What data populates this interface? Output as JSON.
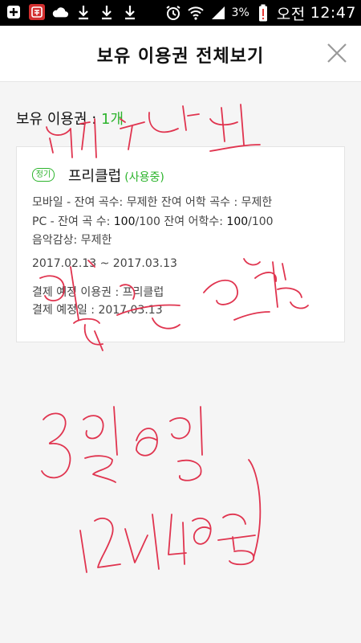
{
  "status_bar": {
    "battery_percent": "3%",
    "ampm": "오전",
    "time": "12:47",
    "icons": [
      "add-icon",
      "app-notification-icon",
      "cloud-icon",
      "download-icon",
      "download-icon",
      "download-icon",
      "alarm-icon",
      "wifi-icon",
      "signal-icon",
      "battery-low-icon"
    ]
  },
  "header": {
    "title": "보유 이용권 전체보기",
    "close_icon": "close-icon"
  },
  "summary": {
    "label": "보유 이용권 :",
    "count": "1개"
  },
  "pass": {
    "tag": "정기",
    "name": "프리클럽",
    "status": "(사용중)",
    "mobile_line": "모바일 - 잔여 곡수: 무제한 잔여 어학 곡수 : 무제한",
    "pc_prefix": "PC - 잔여 곡 수: ",
    "pc_songs": "100",
    "pc_songs_total": "/100 잔여 어학수: ",
    "pc_lang": "100",
    "pc_lang_total": "/100",
    "music_line": "음악감상: 무제한",
    "period": "2017.02.13 ~ 2017.03.13",
    "next_pass": "결제 예정 이용권 : 프리클럽",
    "next_date": "결제 예정일 : 2017.03.13"
  },
  "colors": {
    "accent_green": "#2db42d",
    "handwriting_red": "#e0344f"
  }
}
